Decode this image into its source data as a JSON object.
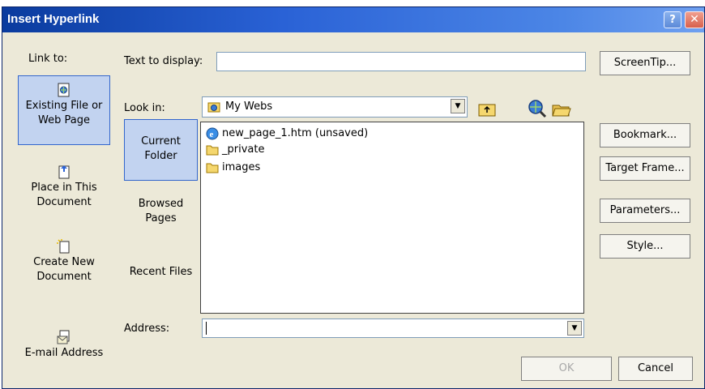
{
  "window": {
    "title": "Insert Hyperlink",
    "help_glyph": "?",
    "close_glyph": "✕"
  },
  "link_to": {
    "label": "Link to:",
    "items": [
      {
        "label": "Existing File or Web Page",
        "icon": "web-page-icon",
        "selected": true
      },
      {
        "label": "Place in This Document",
        "icon": "document-place-icon",
        "selected": false
      },
      {
        "label": "Create New Document",
        "icon": "new-document-icon",
        "selected": false
      },
      {
        "label": "E-mail Address",
        "icon": "email-icon",
        "selected": false
      }
    ]
  },
  "text_to_display": {
    "label": "Text to display:",
    "value": ""
  },
  "look_in": {
    "label": "Look in:",
    "value": "My Webs",
    "tools": [
      "up-folder-icon",
      "browse-web-icon",
      "open-folder-icon"
    ]
  },
  "sidebar": {
    "items": [
      {
        "label": "Current Folder",
        "selected": true
      },
      {
        "label": "Browsed Pages",
        "selected": false
      },
      {
        "label": "Recent Files",
        "selected": false
      }
    ]
  },
  "files": [
    {
      "name": "new_page_1.htm (unsaved)",
      "icon": "ie-page-icon"
    },
    {
      "name": "_private",
      "icon": "folder-icon"
    },
    {
      "name": "images",
      "icon": "folder-icon"
    }
  ],
  "address": {
    "label": "Address:",
    "value": ""
  },
  "buttons": {
    "screentip": "ScreenTip...",
    "bookmark": "Bookmark...",
    "target_frame": "Target Frame...",
    "parameters": "Parameters...",
    "style": "Style...",
    "ok": "OK",
    "cancel": "Cancel"
  },
  "colors": {
    "titlebar": "#2a62d6",
    "dialog_bg": "#ece9d8",
    "selection": "#c2d3f0",
    "folder": "#f5d76e"
  }
}
